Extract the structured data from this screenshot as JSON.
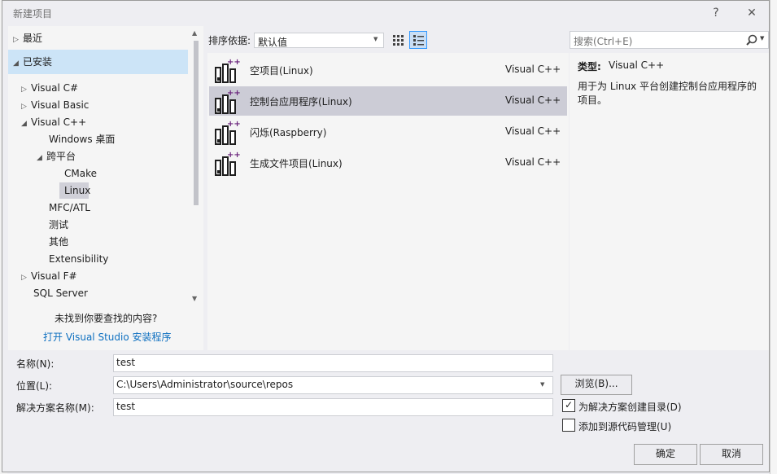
{
  "window": {
    "title": "新建项目",
    "help_label": "?",
    "close_label": "✕"
  },
  "left_tree": {
    "recent": "最近",
    "installed": "已安装",
    "visual_csharp": "Visual C#",
    "visual_basic": "Visual Basic",
    "visual_cpp": "Visual C++",
    "windows_desktop": "Windows 桌面",
    "cross_platform": "跨平台",
    "cmake": "CMake",
    "linux": "Linux",
    "mfc_atl": "MFC/ATL",
    "test": "测试",
    "other": "其他",
    "extensibility": "Extensibility",
    "visual_fsharp": "Visual F#",
    "sql_server": "SQL Server",
    "not_found": "未找到你要查找的内容?",
    "open_installer": "打开 Visual Studio 安装程序"
  },
  "sort": {
    "label": "排序依据:",
    "value": "默认值"
  },
  "templates": [
    {
      "name": "空项目(Linux)",
      "lang": "Visual C++"
    },
    {
      "name": "控制台应用程序(Linux)",
      "lang": "Visual C++"
    },
    {
      "name": "闪烁(Raspberry)",
      "lang": "Visual C++"
    },
    {
      "name": "生成文件项目(Linux)",
      "lang": "Visual C++"
    }
  ],
  "search": {
    "placeholder": "搜索(Ctrl+E)"
  },
  "details": {
    "type_label": "类型:",
    "type_value": "Visual C++",
    "description": "用于为 Linux 平台创建控制台应用程序的项目。"
  },
  "form": {
    "name_label": "名称(N):",
    "name_value": "test",
    "location_label": "位置(L):",
    "location_value": "C:\\Users\\Administrator\\source\\repos",
    "solution_label": "解决方案名称(M):",
    "solution_value": "test",
    "browse_label": "浏览(B)...",
    "create_dir_label": "为解决方案创建目录(D)",
    "create_dir_checked": true,
    "add_scm_label": "添加到源代码管理(U)",
    "add_scm_checked": false
  },
  "buttons": {
    "ok": "确定",
    "cancel": "取消"
  },
  "colors": {
    "selection": "#cce4f7",
    "selected_item": "#ccccd6",
    "link": "#0e70c0",
    "icon_accent": "#68217a"
  }
}
